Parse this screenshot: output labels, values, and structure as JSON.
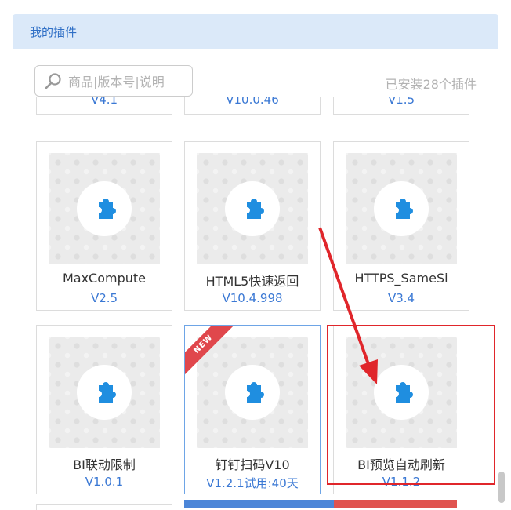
{
  "header": {
    "title": "我的插件"
  },
  "search": {
    "placeholder": "商品|版本号|说明"
  },
  "installed_count_label": "已安装28个插件",
  "partial_row": [
    {
      "version": "V4.1"
    },
    {
      "version": "V10.0.46"
    },
    {
      "version": "V1.5"
    }
  ],
  "plugins": [
    {
      "name": "MaxCompute",
      "version": "V2.5"
    },
    {
      "name": "HTML5快速返回",
      "version": "V10.4.998"
    },
    {
      "name": "HTTPS_SameSi",
      "version": "V3.4"
    },
    {
      "name": "BI联动限制",
      "version": "V1.0.1"
    },
    {
      "name": "钉钉扫码V10",
      "version": "V1.2.1试用:40天",
      "badge": "NEW"
    },
    {
      "name": "BI预览自动刷新",
      "version": "V1.1.2"
    }
  ],
  "colors": {
    "accent": "#2f6fc6",
    "version_text": "#3a78d4",
    "icon": "#1f8ee0",
    "annotation": "#e0262b",
    "badge": "#e0474c"
  }
}
